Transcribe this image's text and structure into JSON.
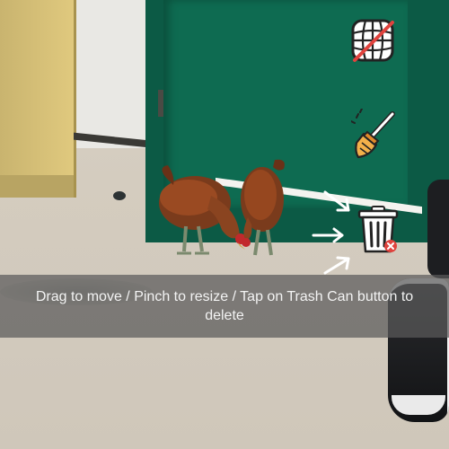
{
  "toast": {
    "message": "Drag to move / Pinch to resize / Tap on Trash Can button to delete"
  },
  "toolbar": {
    "buttons": [
      {
        "id": "grid-off",
        "icon": "grid-off-icon"
      },
      {
        "id": "clear",
        "icon": "broom-icon"
      },
      {
        "id": "delete",
        "icon": "trash-can-icon"
      }
    ]
  },
  "colors": {
    "door": "#0e6b51",
    "toast_bg": "rgba(90,90,90,0.72)",
    "accent_red": "#e0433e"
  }
}
